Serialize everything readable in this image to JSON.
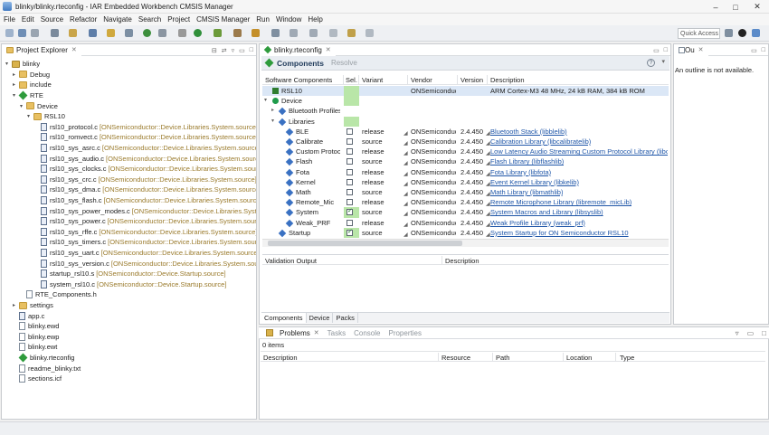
{
  "window": {
    "title": "blinky/blinky.rteconfig - IAR Embedded Workbench CMSIS Manager",
    "minimize": "–",
    "maximize": "□",
    "close": "✕"
  },
  "menu": [
    "File",
    "Edit",
    "Source",
    "Refactor",
    "Navigate",
    "Search",
    "Project",
    "CMSIS Manager",
    "Run",
    "Window",
    "Help"
  ],
  "toolbar": {
    "quick_access": "Quick Access"
  },
  "project_explorer": {
    "tab": "Project Explorer",
    "items": [
      {
        "depth": 0,
        "twisty": "▾",
        "icon": "proj",
        "label": "blinky",
        "src": ""
      },
      {
        "depth": 1,
        "twisty": "▸",
        "icon": "folder",
        "label": "Debug",
        "src": ""
      },
      {
        "depth": 1,
        "twisty": "▸",
        "icon": "folder",
        "label": "include",
        "src": ""
      },
      {
        "depth": 1,
        "twisty": "▾",
        "icon": "diamond",
        "label": "RTE",
        "src": ""
      },
      {
        "depth": 2,
        "twisty": "▾",
        "icon": "folder",
        "label": "Device",
        "src": ""
      },
      {
        "depth": 3,
        "twisty": "▾",
        "icon": "folder",
        "label": "RSL10",
        "src": ""
      },
      {
        "depth": 4,
        "twisty": "",
        "icon": "cfile",
        "label": "rsl10_protocol.c",
        "src": "[ONSemiconductor::Device.Libraries.System.source]"
      },
      {
        "depth": 4,
        "twisty": "",
        "icon": "cfile",
        "label": "rsl10_romvect.c",
        "src": "[ONSemiconductor::Device.Libraries.System.source]"
      },
      {
        "depth": 4,
        "twisty": "",
        "icon": "cfile",
        "label": "rsl10_sys_asrc.c",
        "src": "[ONSemiconductor::Device.Libraries.System.source]"
      },
      {
        "depth": 4,
        "twisty": "",
        "icon": "cfile",
        "label": "rsl10_sys_audio.c",
        "src": "[ONSemiconductor::Device.Libraries.System.source]"
      },
      {
        "depth": 4,
        "twisty": "",
        "icon": "cfile",
        "label": "rsl10_sys_clocks.c",
        "src": "[ONSemiconductor::Device.Libraries.System.source]"
      },
      {
        "depth": 4,
        "twisty": "",
        "icon": "cfile",
        "label": "rsl10_sys_crc.c",
        "src": "[ONSemiconductor::Device.Libraries.System.source]"
      },
      {
        "depth": 4,
        "twisty": "",
        "icon": "cfile",
        "label": "rsl10_sys_dma.c",
        "src": "[ONSemiconductor::Device.Libraries.System.source]"
      },
      {
        "depth": 4,
        "twisty": "",
        "icon": "cfile",
        "label": "rsl10_sys_flash.c",
        "src": "[ONSemiconductor::Device.Libraries.System.source]"
      },
      {
        "depth": 4,
        "twisty": "",
        "icon": "cfile",
        "label": "rsl10_sys_power_modes.c",
        "src": "[ONSemiconductor::Device.Libraries.System.source]"
      },
      {
        "depth": 4,
        "twisty": "",
        "icon": "cfile",
        "label": "rsl10_sys_power.c",
        "src": "[ONSemiconductor::Device.Libraries.System.source]"
      },
      {
        "depth": 4,
        "twisty": "",
        "icon": "cfile",
        "label": "rsl10_sys_rffe.c",
        "src": "[ONSemiconductor::Device.Libraries.System.source]"
      },
      {
        "depth": 4,
        "twisty": "",
        "icon": "cfile",
        "label": "rsl10_sys_timers.c",
        "src": "[ONSemiconductor::Device.Libraries.System.source]"
      },
      {
        "depth": 4,
        "twisty": "",
        "icon": "cfile",
        "label": "rsl10_sys_uart.c",
        "src": "[ONSemiconductor::Device.Libraries.System.source]"
      },
      {
        "depth": 4,
        "twisty": "",
        "icon": "cfile",
        "label": "rsl10_sys_version.c",
        "src": "[ONSemiconductor::Device.Libraries.System.source]"
      },
      {
        "depth": 4,
        "twisty": "",
        "icon": "cfile",
        "label": "startup_rsl10.s",
        "src": "[ONSemiconductor::Device.Startup.source]"
      },
      {
        "depth": 4,
        "twisty": "",
        "icon": "cfile",
        "label": "system_rsl10.c",
        "src": "[ONSemiconductor::Device.Startup.source]"
      },
      {
        "depth": 2,
        "twisty": "",
        "icon": "file",
        "label": "RTE_Components.h",
        "src": ""
      },
      {
        "depth": 1,
        "twisty": "▸",
        "icon": "folder",
        "label": "settings",
        "src": ""
      },
      {
        "depth": 1,
        "twisty": "",
        "icon": "cfile",
        "label": "app.c",
        "src": ""
      },
      {
        "depth": 1,
        "twisty": "",
        "icon": "file",
        "label": "blinky.ewd",
        "src": ""
      },
      {
        "depth": 1,
        "twisty": "",
        "icon": "file",
        "label": "blinky.ewp",
        "src": ""
      },
      {
        "depth": 1,
        "twisty": "",
        "icon": "file",
        "label": "blinky.ewt",
        "src": ""
      },
      {
        "depth": 1,
        "twisty": "",
        "icon": "diamond",
        "label": "blinky.rteconfig",
        "src": ""
      },
      {
        "depth": 1,
        "twisty": "",
        "icon": "file",
        "label": "readme_blinky.txt",
        "src": ""
      },
      {
        "depth": 1,
        "twisty": "",
        "icon": "file",
        "label": "sections.icf",
        "src": ""
      }
    ]
  },
  "editor": {
    "tab": "blinky.rteconfig",
    "header_title": "Components",
    "resolve": "Resolve",
    "help": "?",
    "columns": {
      "component": "Software Components",
      "sel": "Sel.",
      "variant": "Variant",
      "vendor": "Vendor",
      "version": "Version",
      "description": "Description"
    },
    "rows": [
      {
        "indent": 1,
        "twisty": "",
        "icon": "chip",
        "name": "RSL10",
        "sel": "green",
        "variant": "",
        "vendor": "ONSemiconduc",
        "version": "",
        "description": "ARM Cortex-M3 48 MHz, 24 kB RAM, 384 kB ROM",
        "link": false,
        "selected": true
      },
      {
        "indent": 1,
        "twisty": "▾",
        "icon": "gear",
        "name": "Device",
        "sel": "green",
        "variant": "",
        "vendor": "",
        "version": "",
        "description": "",
        "link": false
      },
      {
        "indent": 2,
        "twisty": "▸",
        "icon": "comp",
        "name": "Bluetooth Profiles",
        "sel": "",
        "variant": "",
        "vendor": "",
        "version": "",
        "description": "",
        "link": false
      },
      {
        "indent": 2,
        "twisty": "▾",
        "icon": "comp",
        "name": "Libraries",
        "sel": "green",
        "variant": "",
        "vendor": "",
        "version": "",
        "description": "",
        "link": false
      },
      {
        "indent": 3,
        "twisty": "",
        "icon": "comp",
        "name": "BLE",
        "sel": "off",
        "variant": "release",
        "vendor": "ONSemiconduc",
        "version": "2.4.450",
        "description": "Bluetooth Stack (libblelib)",
        "link": true
      },
      {
        "indent": 3,
        "twisty": "",
        "icon": "comp",
        "name": "Calibrate",
        "sel": "off",
        "variant": "source",
        "vendor": "ONSemiconduc",
        "version": "2.4.450",
        "description": "Calibration Library (libcalibratelib)",
        "link": true
      },
      {
        "indent": 3,
        "twisty": "",
        "icon": "comp",
        "name": "Custom Protocol",
        "sel": "off",
        "variant": "release",
        "vendor": "ONSemiconduc",
        "version": "2.4.450",
        "description": "Low Latency Audio Streaming Custom Protocol Library (libc",
        "link": true
      },
      {
        "indent": 3,
        "twisty": "",
        "icon": "comp",
        "name": "Flash",
        "sel": "off",
        "variant": "source",
        "vendor": "ONSemiconduc",
        "version": "2.4.450",
        "description": "Flash Library (libflashlib)",
        "link": true
      },
      {
        "indent": 3,
        "twisty": "",
        "icon": "comp",
        "name": "Fota",
        "sel": "off",
        "variant": "release",
        "vendor": "ONSemiconduc",
        "version": "2.4.450",
        "description": "Fota Library (libfota)",
        "link": true
      },
      {
        "indent": 3,
        "twisty": "",
        "icon": "comp",
        "name": "Kernel",
        "sel": "off",
        "variant": "release",
        "vendor": "ONSemiconduc",
        "version": "2.4.450",
        "description": "Event Kernel Library (libkelib)",
        "link": true
      },
      {
        "indent": 3,
        "twisty": "",
        "icon": "comp",
        "name": "Math",
        "sel": "off",
        "variant": "source",
        "vendor": "ONSemiconduc",
        "version": "2.4.450",
        "description": "Math Library (libmathlib)",
        "link": true
      },
      {
        "indent": 3,
        "twisty": "",
        "icon": "comp",
        "name": "Remote_Mic",
        "sel": "off",
        "variant": "release",
        "vendor": "ONSemiconduc",
        "version": "2.4.450",
        "description": "Remote Microphone Library (libremote_micLib)",
        "link": true
      },
      {
        "indent": 3,
        "twisty": "",
        "icon": "comp",
        "name": "System",
        "sel": "on",
        "variant": "source",
        "vendor": "ONSemiconduc",
        "version": "2.4.450",
        "description": "System Macros and Library (libsyslib)",
        "link": true
      },
      {
        "indent": 3,
        "twisty": "",
        "icon": "comp",
        "name": "Weak_PRF",
        "sel": "off",
        "variant": "release",
        "vendor": "ONSemiconduc",
        "version": "2.4.450",
        "description": "Weak Profile Library (weak_prf)",
        "link": true
      },
      {
        "indent": 2,
        "twisty": "",
        "icon": "comp",
        "name": "Startup",
        "sel": "on",
        "variant": "source",
        "vendor": "ONSemiconduc",
        "version": "2.4.450",
        "description": "System Startup for ON Semiconductor RSL10",
        "link": true
      }
    ],
    "validation": {
      "col_output": "Validation Output",
      "col_description": "Description"
    },
    "bottom_tabs": [
      "Components",
      "Device",
      "Packs"
    ]
  },
  "outline": {
    "tab": "Ou",
    "message": "An outline is not available."
  },
  "problems": {
    "tabs": [
      "Problems",
      "Tasks",
      "Console",
      "Properties"
    ],
    "count": "0 items",
    "columns": [
      "Description",
      "Resource",
      "Path",
      "Location",
      "Type"
    ]
  }
}
